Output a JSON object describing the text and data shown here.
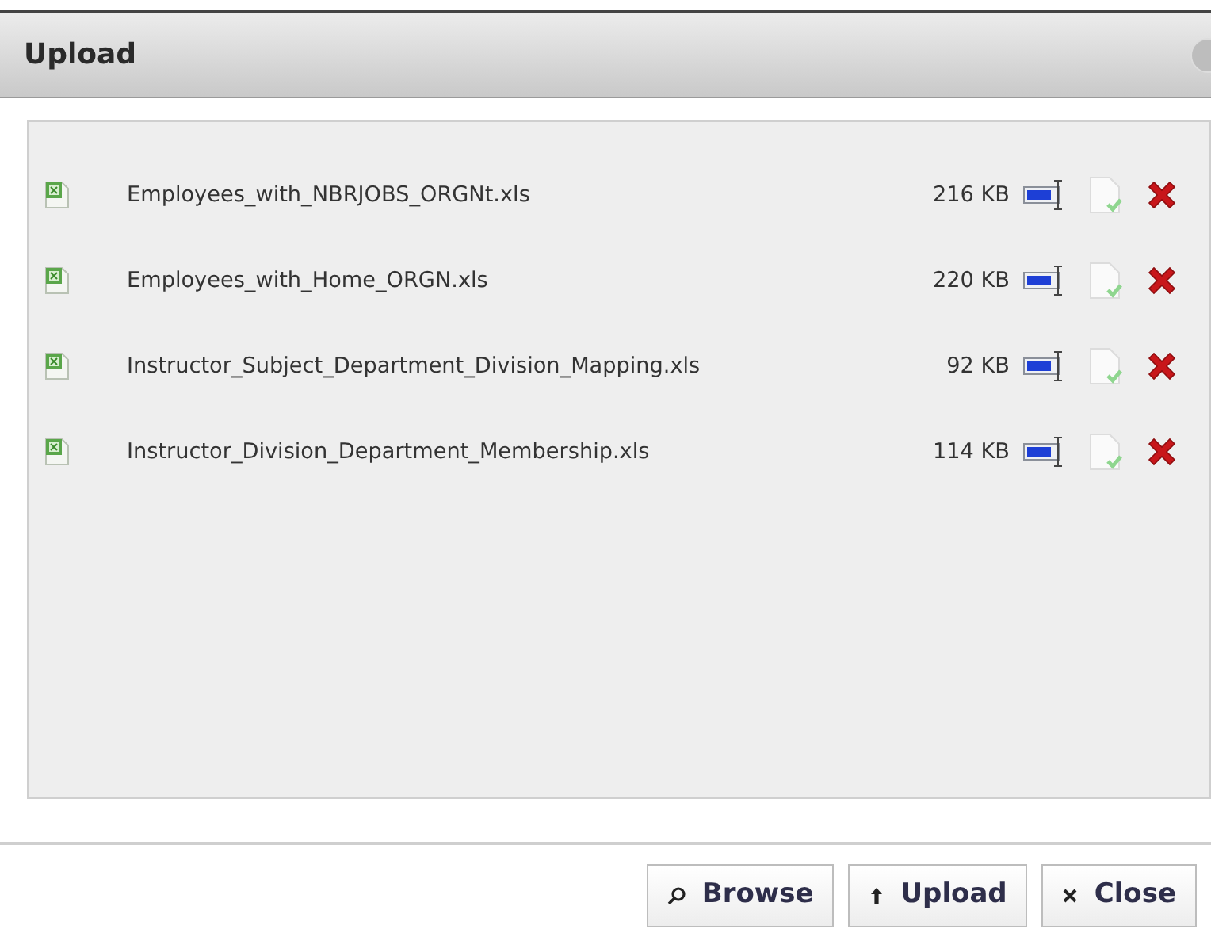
{
  "dialog": {
    "title": "Upload"
  },
  "files": [
    {
      "name": "Employees_with_NBRJOBS_ORGNt.xls",
      "size": "216 KB"
    },
    {
      "name": "Employees_with_Home_ORGN.xls",
      "size": "220 KB"
    },
    {
      "name": "Instructor_Subject_Department_Division_Mapping.xls",
      "size": "92 KB"
    },
    {
      "name": "Instructor_Division_Department_Membership.xls",
      "size": "114 KB"
    }
  ],
  "buttons": [
    {
      "kind": "browse",
      "label": "Browse"
    },
    {
      "kind": "upload",
      "label": "Upload"
    },
    {
      "kind": "close",
      "label": "Close"
    }
  ]
}
